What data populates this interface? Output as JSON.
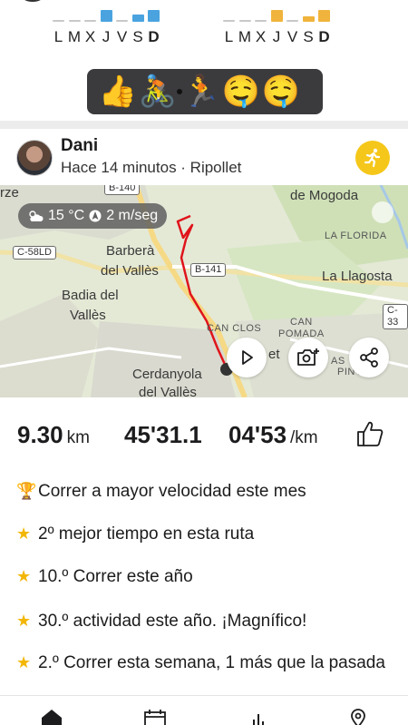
{
  "weekly_summary": {
    "left": {
      "days": [
        "L",
        "M",
        "X",
        "J",
        "V",
        "S",
        "D"
      ],
      "bold_day_index": 6,
      "color": "#4aa3df",
      "values": [
        0.05,
        0.1,
        0.05,
        0.8,
        0.05,
        0.5,
        0.8
      ]
    },
    "right": {
      "days": [
        "L",
        "M",
        "X",
        "J",
        "V",
        "S",
        "D"
      ],
      "bold_day_index": 6,
      "color": "#f0b43c",
      "values": [
        0.05,
        0.05,
        0.05,
        0.8,
        0.05,
        0.4,
        0.8
      ]
    },
    "empty_color": "#c8c8c8"
  },
  "reactions": {
    "emojis": [
      "👍",
      "🚴",
      "•",
      "🏃",
      "🤤",
      "🤤"
    ]
  },
  "post": {
    "user_name": "Dani",
    "meta": "Hace 14 minutos · Ripollet",
    "activity_icon": "running-icon",
    "accent_color": "#f5c71a"
  },
  "map": {
    "weather": {
      "temperature": "15 °C",
      "wind": "2 m/seg",
      "icon": "partly-cloudy-icon",
      "wind_icon": "wind-direction-icon"
    },
    "labels": {
      "de_mogoda": "de Mogoda",
      "la_florida": "LA FLORIDA",
      "la_llagosta": "La Llagosta",
      "barbera": "Barberà",
      "del_valles_1": "del Vallès",
      "badia": "Badia del",
      "valles": "Vallès",
      "can_clos": "CAN CLOS",
      "can": "CAN",
      "pomada": "POMADA",
      "cerdanyola": "Cerdanyola",
      "del_valles_2": "del Vallès",
      "rze": "rze",
      "et": "et",
      "as": "AS",
      "piny": "PINY"
    },
    "roads": {
      "c58ld": "C-58LD",
      "b141": "B-141",
      "b140": "B-140",
      "c33": "C-33"
    },
    "route_color": "#e0141b",
    "buttons": {
      "play": "play-icon",
      "add_photo": "add-photo-icon",
      "share": "share-icon"
    }
  },
  "stats": {
    "distance": "9.30",
    "distance_unit": "km",
    "duration": "45'31.1",
    "pace": "04'53",
    "pace_unit": "/km"
  },
  "achievements": [
    {
      "icon": "trophy-icon",
      "text": "Correr a mayor velocidad este mes"
    },
    {
      "icon": "star-icon",
      "text": "2º mejor tiempo en esta ruta"
    },
    {
      "icon": "star-icon",
      "text": "10.º Correr este año"
    },
    {
      "icon": "star-icon",
      "text": "30.º actividad este año. ¡Magnífico!"
    },
    {
      "icon": "star-icon",
      "text": "2.º Correr esta semana, 1 más que la pasada"
    }
  ],
  "bottom_nav": [
    "home-icon",
    "calendar-icon",
    "stats-icon",
    "explore-icon"
  ]
}
